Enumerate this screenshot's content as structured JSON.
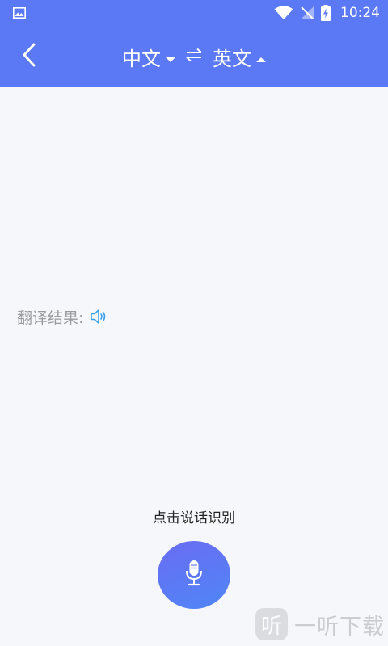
{
  "status_bar": {
    "time": "10:24",
    "icons": [
      "gallery-icon",
      "wifi-icon",
      "no-signal-icon",
      "battery-charging-icon"
    ]
  },
  "nav": {
    "back_icon": "chevron-left-icon",
    "source_lang": "中文",
    "target_lang": "英文",
    "swap_icon": "swap-arrows-icon"
  },
  "result": {
    "label": "翻译结果:",
    "speaker_icon": "speaker-icon"
  },
  "voice": {
    "hint": "点击说话识别",
    "mic_icon": "microphone-icon"
  },
  "watermark": {
    "logo_char": "听",
    "text": "一听下载"
  },
  "colors": {
    "header": "#5b78f5",
    "background": "#f6f7fa",
    "speaker": "#3aa0e8",
    "mic_gradient_start": "#6a6cf2",
    "mic_gradient_end": "#4f86f7"
  }
}
